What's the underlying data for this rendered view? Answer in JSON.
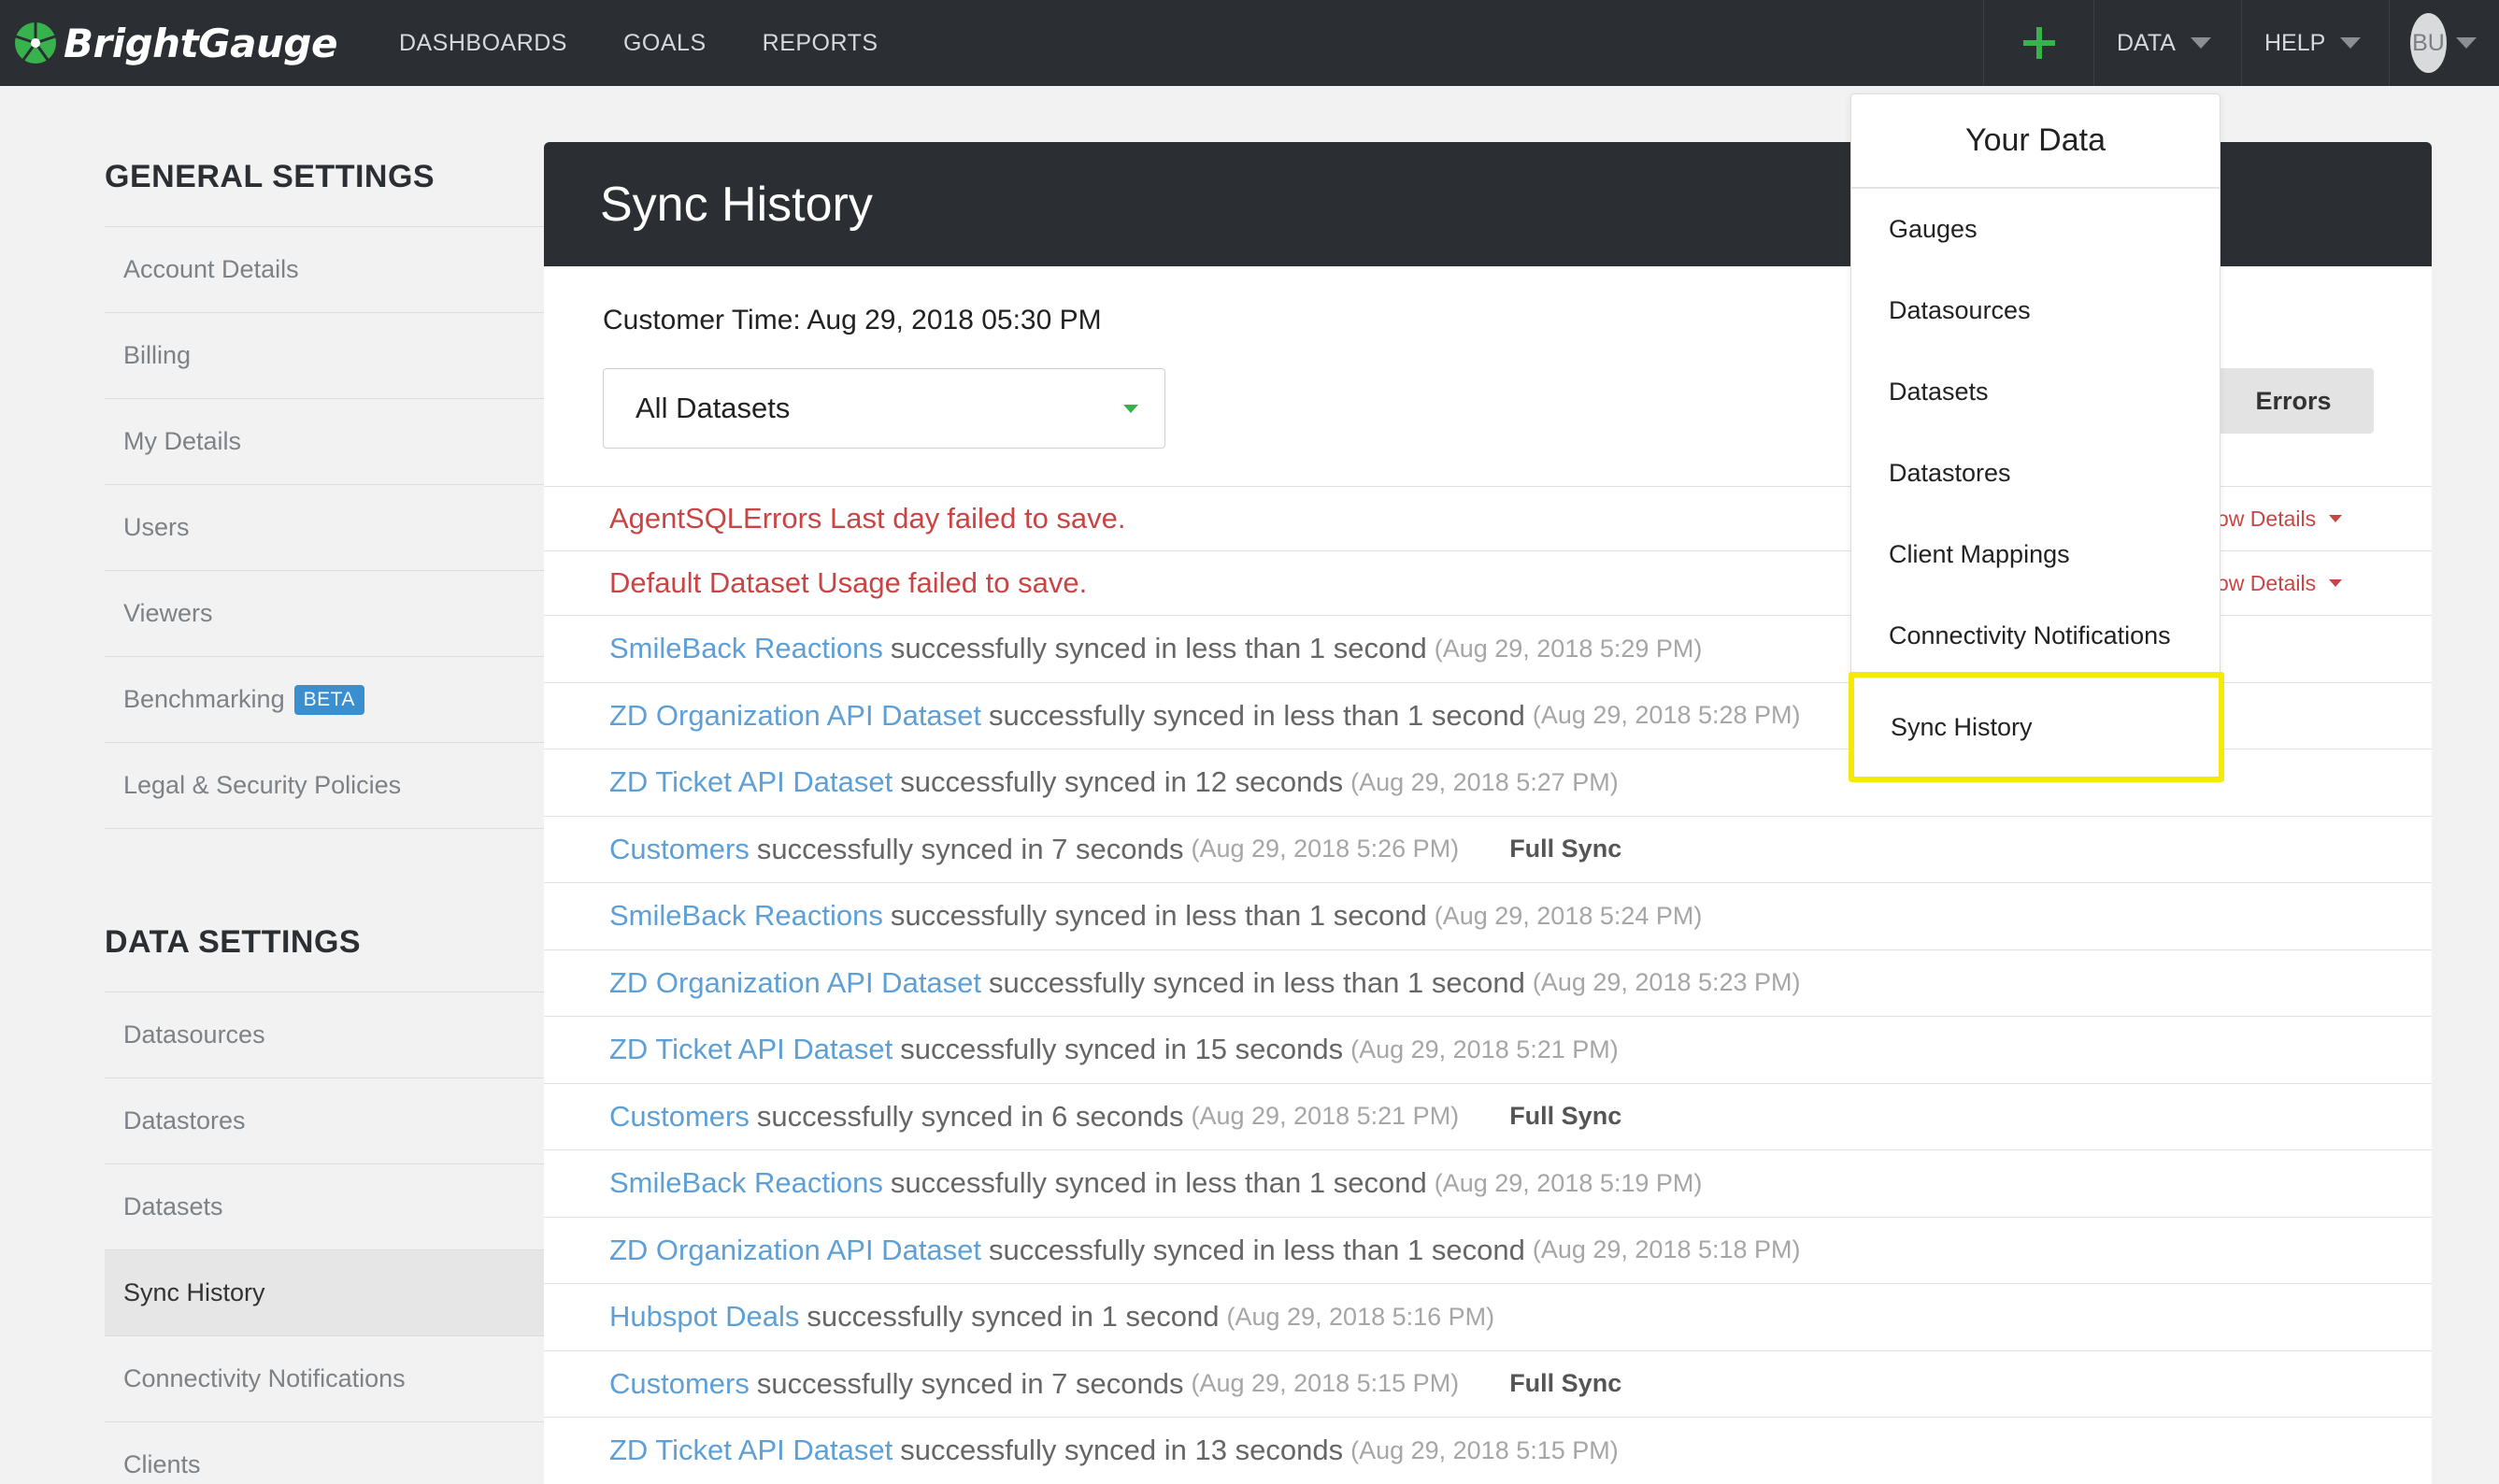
{
  "app": {
    "name": "BrightGauge"
  },
  "topnav": {
    "links": [
      "DASHBOARDS",
      "GOALS",
      "REPORTS"
    ],
    "add_icon": "plus-icon",
    "data_label": "DATA",
    "help_label": "HELP",
    "user_initials": "BU"
  },
  "sidebar": {
    "general_heading": "GENERAL SETTINGS",
    "general_items": [
      "Account Details",
      "Billing",
      "My Details",
      "Users",
      "Viewers",
      "Benchmarking",
      "Legal & Security Policies"
    ],
    "beta_badge": "BETA",
    "data_heading": "DATA SETTINGS",
    "data_items": [
      "Datasources",
      "Datastores",
      "Datasets",
      "Sync History",
      "Connectivity Notifications",
      "Clients"
    ],
    "active_item": "Sync History"
  },
  "main": {
    "title": "Sync History",
    "customer_time": "Customer Time: Aug 29, 2018 05:30 PM",
    "dataset_filter": "All Datasets",
    "errors_button": "Errors",
    "show_details_label": "ow Details",
    "rows": [
      {
        "type": "error",
        "name": "AgentSQLErrors Last day",
        "message": "failed to save.",
        "timestamp": "",
        "full": ""
      },
      {
        "type": "error",
        "name": "Default Dataset Usage",
        "message": "failed to save.",
        "timestamp": "",
        "full": ""
      },
      {
        "type": "ok",
        "name": "SmileBack Reactions",
        "message": "successfully synced in less than 1 second",
        "timestamp": "(Aug 29, 2018 5:29 PM)",
        "full": ""
      },
      {
        "type": "ok",
        "name": "ZD Organization API Dataset",
        "message": "successfully synced in less than 1 second",
        "timestamp": "(Aug 29, 2018 5:28 PM)",
        "full": ""
      },
      {
        "type": "ok",
        "name": "ZD Ticket API Dataset",
        "message": "successfully synced in 12 seconds",
        "timestamp": "(Aug 29, 2018 5:27 PM)",
        "full": ""
      },
      {
        "type": "ok",
        "name": "Customers",
        "message": "successfully synced in 7 seconds",
        "timestamp": "(Aug 29, 2018 5:26 PM)",
        "full": "Full Sync"
      },
      {
        "type": "ok",
        "name": "SmileBack Reactions",
        "message": "successfully synced in less than 1 second",
        "timestamp": "(Aug 29, 2018 5:24 PM)",
        "full": ""
      },
      {
        "type": "ok",
        "name": "ZD Organization API Dataset",
        "message": "successfully synced in less than 1 second",
        "timestamp": "(Aug 29, 2018 5:23 PM)",
        "full": ""
      },
      {
        "type": "ok",
        "name": "ZD Ticket API Dataset",
        "message": "successfully synced in 15 seconds",
        "timestamp": "(Aug 29, 2018 5:21 PM)",
        "full": ""
      },
      {
        "type": "ok",
        "name": "Customers",
        "message": "successfully synced in 6 seconds",
        "timestamp": "(Aug 29, 2018 5:21 PM)",
        "full": "Full Sync"
      },
      {
        "type": "ok",
        "name": "SmileBack Reactions",
        "message": "successfully synced in less than 1 second",
        "timestamp": "(Aug 29, 2018 5:19 PM)",
        "full": ""
      },
      {
        "type": "ok",
        "name": "ZD Organization API Dataset",
        "message": "successfully synced in less than 1 second",
        "timestamp": "(Aug 29, 2018 5:18 PM)",
        "full": ""
      },
      {
        "type": "ok",
        "name": "Hubspot Deals",
        "message": "successfully synced in 1 second",
        "timestamp": "(Aug 29, 2018 5:16 PM)",
        "full": ""
      },
      {
        "type": "ok",
        "name": "Customers",
        "message": "successfully synced in 7 seconds",
        "timestamp": "(Aug 29, 2018 5:15 PM)",
        "full": "Full Sync"
      },
      {
        "type": "ok",
        "name": "ZD Ticket API Dataset",
        "message": "successfully synced in 13 seconds",
        "timestamp": "(Aug 29, 2018 5:15 PM)",
        "full": ""
      }
    ]
  },
  "dropdown": {
    "title": "Your Data",
    "items": [
      "Gauges",
      "Datasources",
      "Datasets",
      "Datastores",
      "Client Mappings",
      "Connectivity Notifications"
    ],
    "highlighted_item": "Sync History"
  },
  "colors": {
    "nav_bg": "#2b2f33",
    "link_blue": "#5ea0d6",
    "error_red": "#c94545",
    "accent_green": "#37b24d",
    "highlight_yellow": "#f5e90a",
    "beta_blue": "#3a8fd0"
  }
}
